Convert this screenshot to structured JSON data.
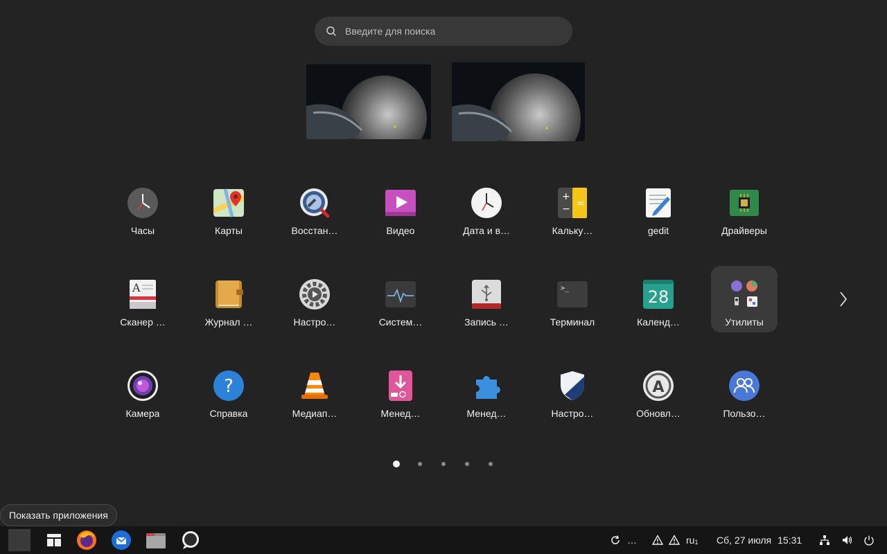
{
  "search": {
    "placeholder": "Введите для поиска",
    "icon": "search-icon"
  },
  "apps": [
    {
      "label": "Часы",
      "icon": "clock-icon"
    },
    {
      "label": "Карты",
      "icon": "maps-icon"
    },
    {
      "label": "Восстан…",
      "icon": "recovery-icon"
    },
    {
      "label": "Видео",
      "icon": "video-icon"
    },
    {
      "label": "Дата и в…",
      "icon": "datetime-icon"
    },
    {
      "label": "Кальку…",
      "icon": "calculator-icon"
    },
    {
      "label": "gedit",
      "icon": "gedit-icon"
    },
    {
      "label": "Драйверы",
      "icon": "drivers-icon"
    },
    {
      "label": "Сканер …",
      "icon": "scanner-icon"
    },
    {
      "label": "Журнал …",
      "icon": "journal-icon"
    },
    {
      "label": "Настро…",
      "icon": "settings-gear-icon"
    },
    {
      "label": "Систем…",
      "icon": "system-monitor-icon"
    },
    {
      "label": "Запись …",
      "icon": "usb-writer-icon"
    },
    {
      "label": "Терминал",
      "icon": "terminal-icon"
    },
    {
      "label": "Календ…",
      "icon": "calendar-icon",
      "day": "28"
    },
    {
      "label": "Утилиты",
      "icon": "utilities-folder-icon"
    },
    {
      "label": "Камера",
      "icon": "camera-icon"
    },
    {
      "label": "Справка",
      "icon": "help-icon"
    },
    {
      "label": "Медиап…",
      "icon": "vlc-icon"
    },
    {
      "label": "Менед…",
      "icon": "package-manager-icon"
    },
    {
      "label": "Менед…",
      "icon": "extensions-icon"
    },
    {
      "label": "Настро…",
      "icon": "firewall-icon"
    },
    {
      "label": "Обновл…",
      "icon": "software-updater-icon"
    },
    {
      "label": "Пользо…",
      "icon": "users-icon"
    }
  ],
  "pagination": {
    "pages": 5,
    "current": 1
  },
  "tooltip": {
    "text": "Показать приложения"
  },
  "taskbar": {
    "apps": [
      "show-apps-button",
      "window-layout-icon",
      "firefox-icon",
      "thunderbird-icon",
      "files-icon",
      "chat-icon"
    ],
    "tray": {
      "refresh_text": "…",
      "lang": "ru",
      "lang_sub": "1",
      "date": "Сб, 27 июля",
      "time": "15:31"
    }
  },
  "colors": {
    "background": "#232323",
    "panel": "#151515",
    "folder_bg": "#3a3a3a",
    "accent": "#e95420"
  }
}
